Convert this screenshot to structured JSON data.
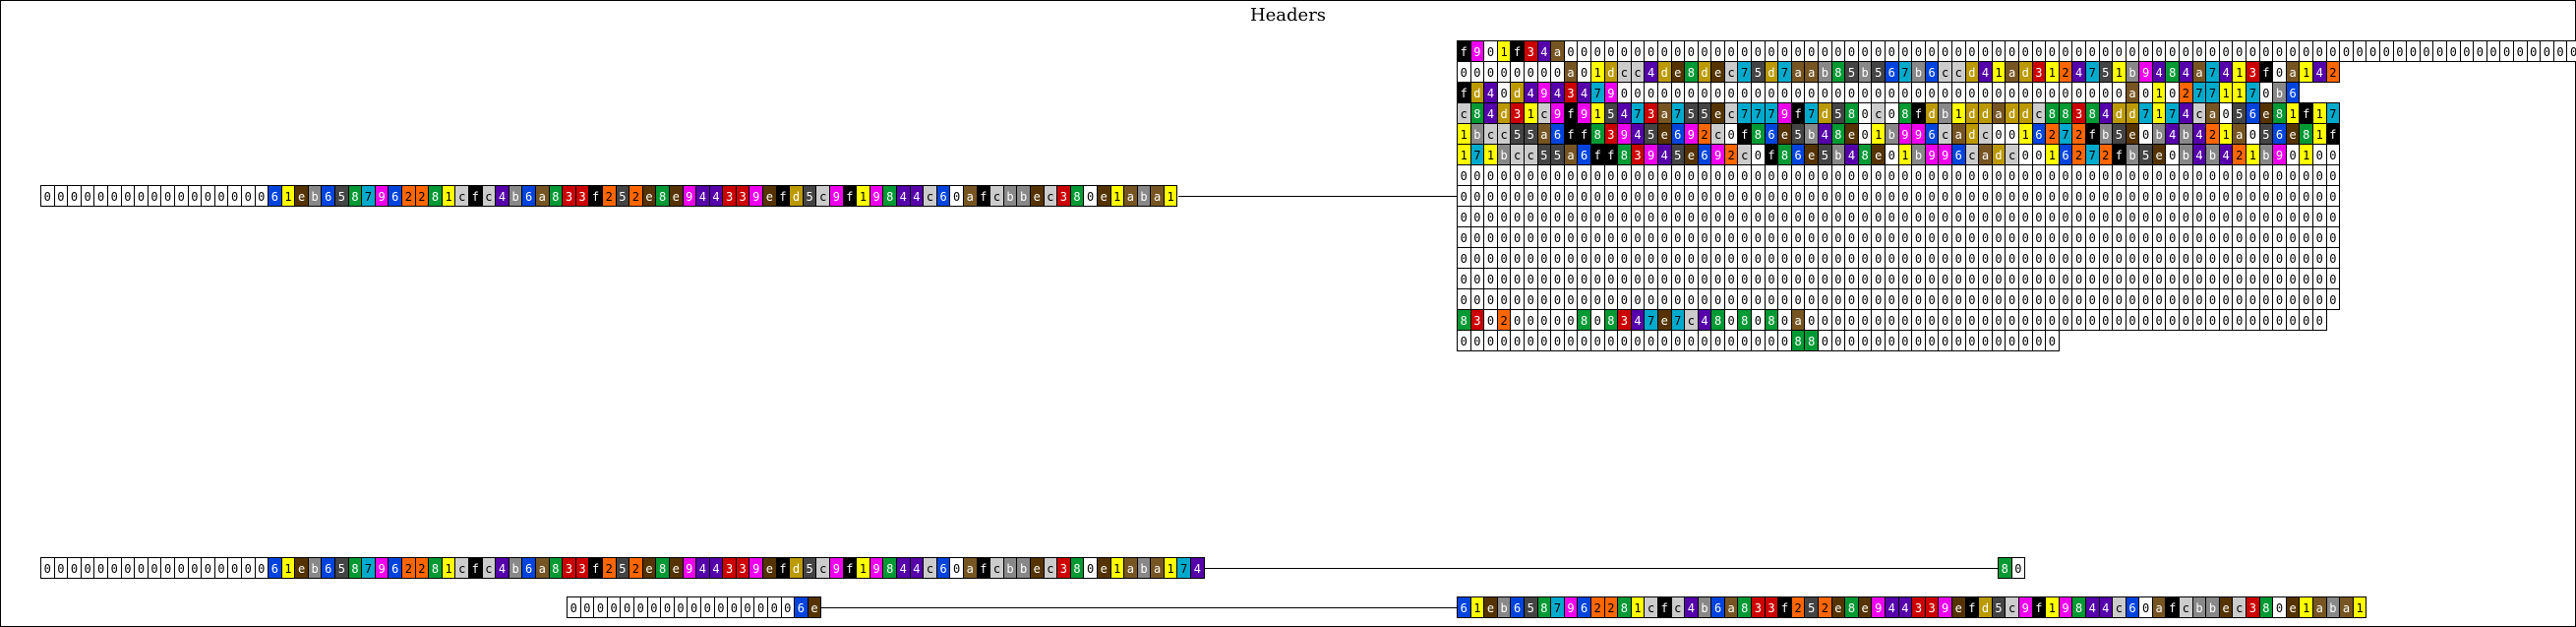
{
  "title": "Headers",
  "palette": {
    "0": {
      "bg": "#ffffff",
      "fg": "#000000"
    },
    "1": {
      "bg": "#ffff00",
      "fg": "#000000"
    },
    "2": {
      "bg": "#ff6600",
      "fg": "#000000"
    },
    "3": {
      "bg": "#cc0000",
      "fg": "#ffffff"
    },
    "4": {
      "bg": "#5500aa",
      "fg": "#ffffff"
    },
    "5": {
      "bg": "#444444",
      "fg": "#ffffff"
    },
    "6": {
      "bg": "#0044dd",
      "fg": "#ffffff"
    },
    "7": {
      "bg": "#00aacc",
      "fg": "#000000"
    },
    "8": {
      "bg": "#009933",
      "fg": "#ffffff"
    },
    "9": {
      "bg": "#ee00ee",
      "fg": "#ffffff"
    },
    "a": {
      "bg": "#775522",
      "fg": "#ffffff"
    },
    "b": {
      "bg": "#888888",
      "fg": "#ffffff"
    },
    "c": {
      "bg": "#cccccc",
      "fg": "#000000"
    },
    "d": {
      "bg": "#bb9900",
      "fg": "#ffffff"
    },
    "e": {
      "bg": "#553300",
      "fg": "#ffffff"
    },
    "f": {
      "bg": "#000000",
      "fg": "#ffffff"
    }
  },
  "left": {
    "row1": "0000000000000000061eb6587962281cfc4b6a833f252e8e944339efd5c9f19844c60afcbbec380e1aba1",
    "row2": "0000000000000000061eb6587962281cfc4b6a833f252e8e944339efd5c9f19844c60afcbbec380e1aba174",
    "row3": "000000000000000006e"
  },
  "grid": {
    "rows": [
      "f901f34a0000000000000000000000000000000000000000000000000000000000000000000000000000",
      "00000000a01dcc4de8dec75d7aab85b567b6ccd41ad3124751b9484a7413f0a142",
      "fd40d494347900000000000000000000000000000000000000a0102771170b6",
      "c84d31c9f915473a755ec7779f7d580c08fdb1ddaddc88384dd7174ca056e81f17",
      "1bcc55a6ff83945e692c0f86e5b48e01b996cadc0016272fb5e0b4b421a056e81f",
      "171bcc55a6ff83945e692c0f86e5b48e01b996cadc0016272fb5e0b4b421b90100",
      "000000000000000000000000000000000000000000000000000000000000000000",
      "000000000000000000000000000000000000000000000000000000000000000000",
      "000000000000000000000000000000000000000000000000000000000000000000",
      "000000000000000000000000000000000000000000000000000000000000000000",
      "000000000000000000000000000000000000000000000000000000000000000000",
      "000000000000000000000000000000000000000000000000000000000000000000",
      "000000000000000000000000000000000000000000000000000000000000000000",
      "830200000808347e7c4808080a000000000000000000000000000000000000000",
      "000000000000000000000000088000000000000000000"
    ]
  },
  "nodes": {
    "row2_tail": "80",
    "row3_right": "61eb6587962281cfc4b6a833f252e8e944339efd5c9f19844c60afcbbec380e1aba1"
  }
}
